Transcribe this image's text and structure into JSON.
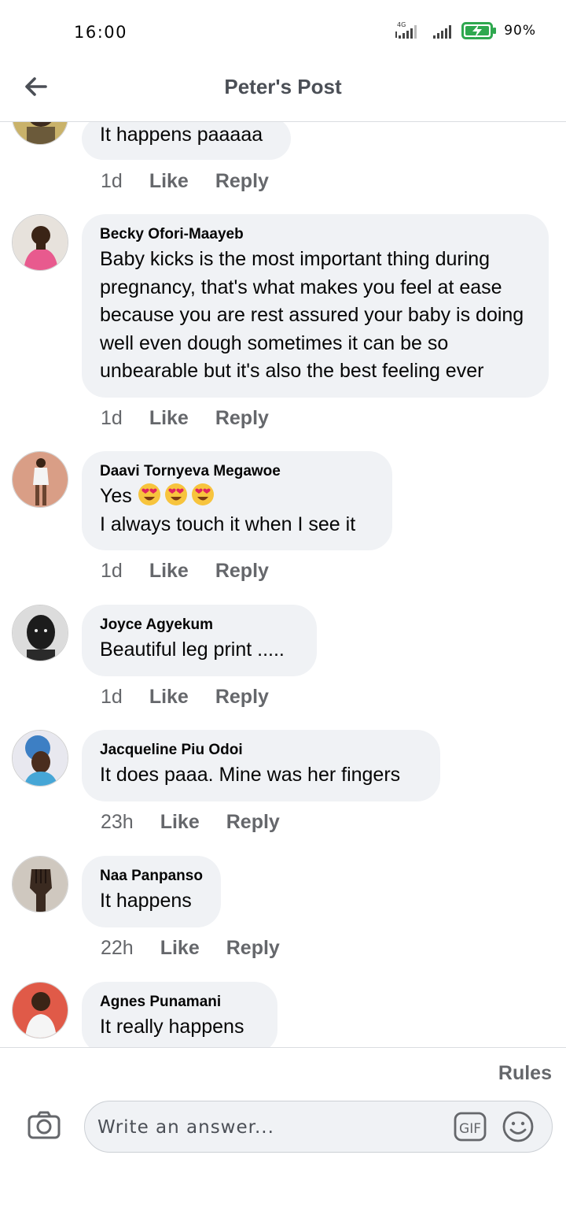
{
  "status_bar": {
    "time": "16:00",
    "network": "4G",
    "battery_percent": "90%"
  },
  "header": {
    "title": "Peter's Post"
  },
  "comments": [
    {
      "author": "",
      "text": "It happens paaaaa",
      "time": "1d",
      "like_label": "Like",
      "reply_label": "Reply"
    },
    {
      "author": "Becky Ofori-Maayeb",
      "text": "Baby kicks is the most important thing during pregnancy, that's what makes you feel at ease because you are rest assured your baby is doing well even dough sometimes it can be so unbearable but it's also the best feeling ever",
      "time": "1d",
      "like_label": "Like",
      "reply_label": "Reply"
    },
    {
      "author": "Daavi Tornyeva Megawoe",
      "text_line1": "Yes",
      "emojis": [
        "heart-eyes-emoji",
        "heart-eyes-emoji",
        "heart-eyes-emoji"
      ],
      "text_line2": "I always touch it when I see it",
      "time": "1d",
      "like_label": "Like",
      "reply_label": "Reply"
    },
    {
      "author": "Joyce Agyekum",
      "text": "Beautiful leg print .....",
      "time": "1d",
      "like_label": "Like",
      "reply_label": "Reply"
    },
    {
      "author": "Jacqueline Piu Odoi",
      "text": "It does paaa. Mine was her fingers",
      "time": "23h",
      "like_label": "Like",
      "reply_label": "Reply"
    },
    {
      "author": "Naa Panpanso",
      "text": "It happens",
      "time": "22h",
      "like_label": "Like",
      "reply_label": "Reply"
    },
    {
      "author": "Agnes Punamani",
      "text": "It really happens"
    }
  ],
  "footer": {
    "rules_label": "Rules",
    "input_placeholder": "Write an answer...",
    "gif_label": "GIF"
  },
  "colors": {
    "bubble_bg": "#f0f2f5",
    "secondary_text": "#65676b",
    "title_text": "#4b4f56",
    "emoji_yellow": "#f7c43d",
    "heart_red": "#e0245e"
  }
}
